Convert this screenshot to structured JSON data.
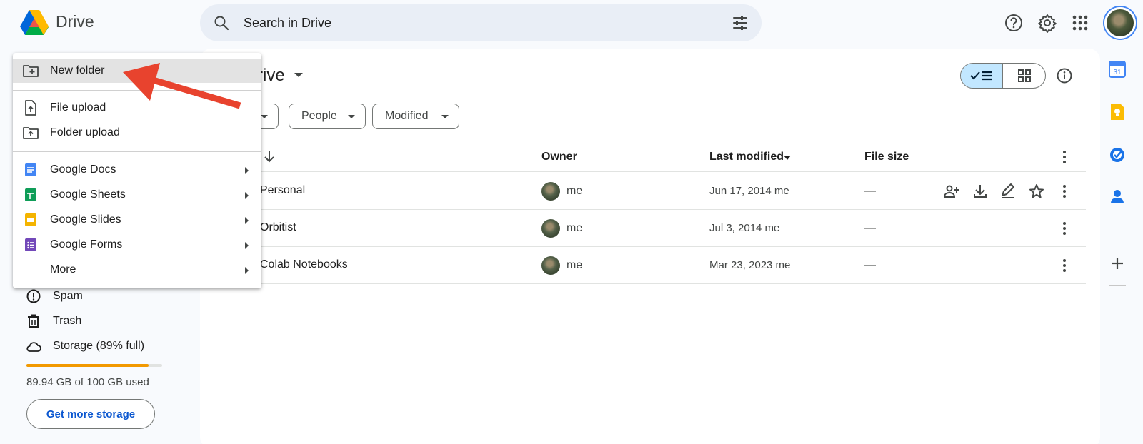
{
  "app": {
    "name": "Drive"
  },
  "search": {
    "placeholder": "Search in Drive"
  },
  "page": {
    "title": "My Drive",
    "title_visible": "rive"
  },
  "filters": [
    {
      "label": ""
    },
    {
      "label": "People"
    },
    {
      "label": "Modified"
    }
  ],
  "table": {
    "columns": {
      "owner": "Owner",
      "modified": "Last modified",
      "size": "File size"
    },
    "rows": [
      {
        "name": "Personal",
        "owner": "me",
        "modified": "Jun 17, 2014  me",
        "size": "—"
      },
      {
        "name": "Orbitist",
        "owner": "me",
        "modified": "Jul 3, 2014  me",
        "size": "—"
      },
      {
        "name": "Colab Notebooks",
        "owner": "me",
        "modified": "Mar 23, 2023  me",
        "size": "—"
      }
    ]
  },
  "menu": {
    "new_folder": "New folder",
    "file_upload": "File upload",
    "folder_upload": "Folder upload",
    "docs": "Google Docs",
    "sheets": "Google Sheets",
    "slides": "Google Slides",
    "forms": "Google Forms",
    "more": "More"
  },
  "nav": {
    "spam": "Spam",
    "trash": "Trash",
    "storage": "Storage (89% full)"
  },
  "storage": {
    "used_text": "89.94 GB of 100 GB used",
    "fraction": 0.8994,
    "button": "Get more storage"
  },
  "colors": {
    "accent": "#0b57d0",
    "arrow": "#e8432e",
    "storage_fill": "#f29900"
  },
  "calendar_day": "31"
}
